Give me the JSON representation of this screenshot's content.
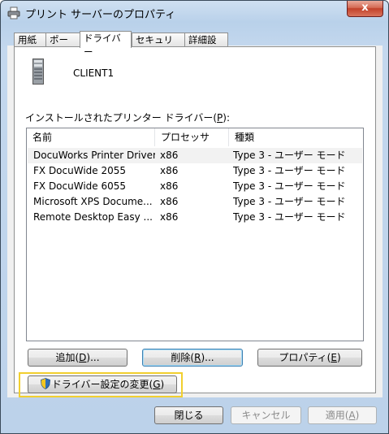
{
  "window": {
    "title": "プリント サーバーのプロパティ",
    "close_label": "x"
  },
  "tabs": [
    {
      "label": "用紙"
    },
    {
      "label": "ポート"
    },
    {
      "label": "ドライバー"
    },
    {
      "label": "セキュリティ"
    },
    {
      "label": "詳細設定"
    }
  ],
  "active_tab": "ドライバー",
  "server": {
    "name": "CLIENT1",
    "icon": "server-icon"
  },
  "drivers": {
    "label_pre": "インストールされたプリンター ドライバー(",
    "label_key": "P",
    "label_post": "):",
    "columns": {
      "name": "名前",
      "processor": "プロセッサ",
      "type": "種類"
    },
    "rows": [
      {
        "name": "DocuWorks Printer Driver",
        "processor": "x86",
        "type": "Type 3 - ユーザー モード"
      },
      {
        "name": "FX DocuWide 2055",
        "processor": "x86",
        "type": "Type 3 - ユーザー モード"
      },
      {
        "name": "FX DocuWide 6055",
        "processor": "x86",
        "type": "Type 3 - ユーザー モード"
      },
      {
        "name": "Microsoft XPS Docume...",
        "processor": "x86",
        "type": "Type 3 - ユーザー モード"
      },
      {
        "name": "Remote Desktop Easy ...",
        "processor": "x86",
        "type": "Type 3 - ユーザー モード"
      }
    ]
  },
  "buttons": {
    "add": {
      "pre": "追加(",
      "key": "D",
      "post": ")..."
    },
    "remove": {
      "pre": "削除(",
      "key": "R",
      "post": ")..."
    },
    "properties": {
      "pre": "プロパティ(",
      "key": "E",
      "post": ")"
    },
    "change_settings": {
      "pre": "ドライバー設定の変更(",
      "key": "G",
      "post": ")"
    },
    "close": "閉じる",
    "cancel": "キャンセル",
    "apply": {
      "pre": "適用(",
      "key": "A",
      "post": ")"
    }
  },
  "colors": {
    "highlight": "#f1cf2f",
    "title_bar": "#b9d1ea",
    "selected_row": "#f2f2f2"
  }
}
